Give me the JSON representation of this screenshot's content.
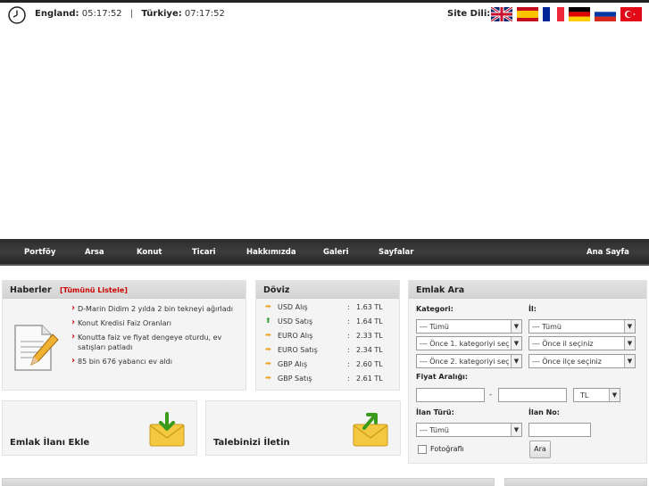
{
  "clock": {
    "england_label": "England:",
    "england_time": "05:17:52",
    "separator": "|",
    "turkiye_label": "Türkiye:",
    "turkiye_time": "07:17:52"
  },
  "language": {
    "label": "Site Dili:",
    "flags": [
      "uk-flag",
      "spain-flag",
      "france-flag",
      "germany-flag",
      "russia-flag",
      "turkey-flag"
    ]
  },
  "nav": {
    "items": [
      "Portföy",
      "Arsa",
      "Konut",
      "Ticari",
      "Hakkımızda",
      "Galeri",
      "Sayfalar"
    ],
    "home": "Ana Sayfa"
  },
  "news": {
    "title": "Haberler",
    "list_all": "[Tümünü Listele]",
    "items": [
      "D-Marin Didim 2 yılda 2 bin tekneyi ağırladı",
      "Konut Kredisi Faiz Oranları",
      "Konutta faiz ve fiyat dengeye oturdu, ev satışları patladı",
      "85 bin 676 yabancı ev aldı"
    ]
  },
  "currency": {
    "title": "Döviz",
    "rows": [
      {
        "name": "USD Alış",
        "value": "1.63 TL",
        "trend": "neutral"
      },
      {
        "name": "USD Satış",
        "value": "1.64 TL",
        "trend": "up"
      },
      {
        "name": "EURO Alış",
        "value": "2.33 TL",
        "trend": "neutral"
      },
      {
        "name": "EURO Satış",
        "value": "2.34 TL",
        "trend": "neutral"
      },
      {
        "name": "GBP Alış",
        "value": "2.60 TL",
        "trend": "neutral"
      },
      {
        "name": "GBP Satış",
        "value": "2.61 TL",
        "trend": "neutral"
      }
    ],
    "colon": ":"
  },
  "search": {
    "title": "Emlak Ara",
    "kategori_label": "Kategori:",
    "il_label": "İl:",
    "kategori_value": "--- Tümü",
    "il_value": "--- Tümü",
    "kategori2_value": "--- Önce 1. kategoriyi seç",
    "ilce_value": "--- Önce il seçiniz",
    "kategori3_value": "--- Önce 2. kategoriyi seç",
    "semt_value": "--- Önce ilçe seçiniz",
    "price_label": "Fiyat Aralığı:",
    "price_dash": "-",
    "currency_value": "TL",
    "ilan_turu_label": "İlan Türü:",
    "ilan_turu_value": "--- Tümü",
    "ilan_no_label": "İlan No:",
    "photo_label": "Fotoğraflı",
    "search_button": "Ara"
  },
  "cta": {
    "add_listing": "Emlak İlanı Ekle",
    "submit_request": "Talebinizi İletin"
  },
  "colors": {
    "accent": "#cc0000",
    "nav_bg": "#333333",
    "panel_bg": "#f4f4f4"
  }
}
